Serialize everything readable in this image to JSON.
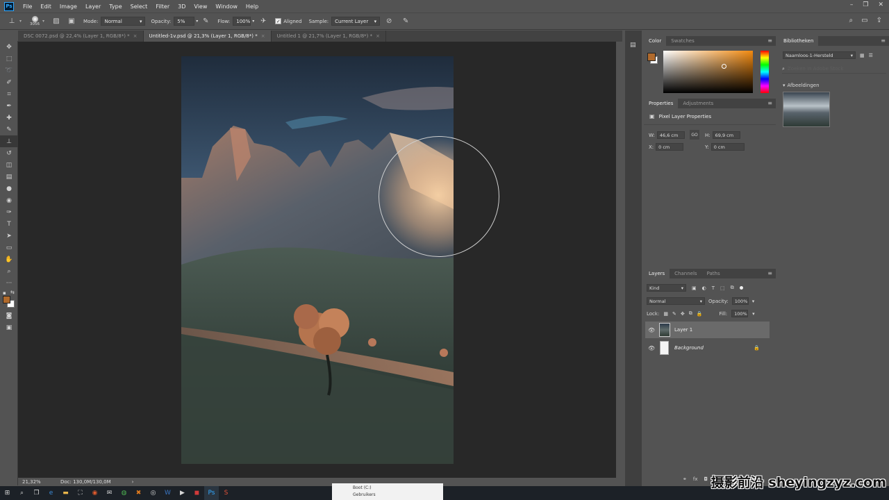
{
  "app": {
    "logo": "Ps"
  },
  "menu": [
    "File",
    "Edit",
    "Image",
    "Layer",
    "Type",
    "Select",
    "Filter",
    "3D",
    "View",
    "Window",
    "Help"
  ],
  "options": {
    "brush_size": "3056",
    "mode_label": "Mode:",
    "mode_value": "Normal",
    "opacity_label": "Opacity:",
    "opacity_value": "5%",
    "flow_label": "Flow:",
    "flow_value": "100%",
    "aligned_label": "Aligned",
    "sample_label": "Sample:",
    "sample_value": "Current Layer"
  },
  "tabs": [
    {
      "label": "DSC 0072.psd @ 22,4% (Layer 1, RGB/8*) *"
    },
    {
      "label": "Untitled-1v.psd @ 21,3% (Layer 1, RGB/8*) *"
    },
    {
      "label": "Untitled 1 @ 21,7% (Layer 1, RGB/8*) *"
    }
  ],
  "status": {
    "zoom": "21,32%",
    "doc": "Doc: 130,0M/130,0M"
  },
  "color_panel": {
    "tab1": "Color",
    "tab2": "Swatches",
    "fg": "#b06a2c",
    "bg": "#ffffff"
  },
  "properties": {
    "tab1": "Properties",
    "tab2": "Adjustments",
    "title": "Pixel Layer Properties",
    "w_label": "W:",
    "w_value": "46,6 cm",
    "link": "GO",
    "h_label": "H:",
    "h_value": "69,9 cm",
    "x_label": "X:",
    "x_value": "0 cm",
    "y_label": "Y:",
    "y_value": "0 cm"
  },
  "layers": {
    "tab1": "Layers",
    "tab2": "Channels",
    "tab3": "Paths",
    "kind": "Kind",
    "blend": "Normal",
    "opacity_label": "Opacity:",
    "opacity_value": "100%",
    "lock_label": "Lock:",
    "fill_label": "Fill:",
    "fill_value": "100%",
    "items": [
      {
        "name": "Layer 1"
      },
      {
        "name": "Background"
      }
    ]
  },
  "libraries": {
    "tab": "Bibliotheken",
    "library": "Naamloos-1-Hersteld",
    "search_placeholder": "Zoeken in Adobe Stock",
    "section": "Afbeeldingen"
  },
  "taskbar_popup": {
    "line1": "Boot (C:)",
    "line2": "Gebruikers"
  },
  "watermark": "摄影前沿 sheyingzyz.com"
}
